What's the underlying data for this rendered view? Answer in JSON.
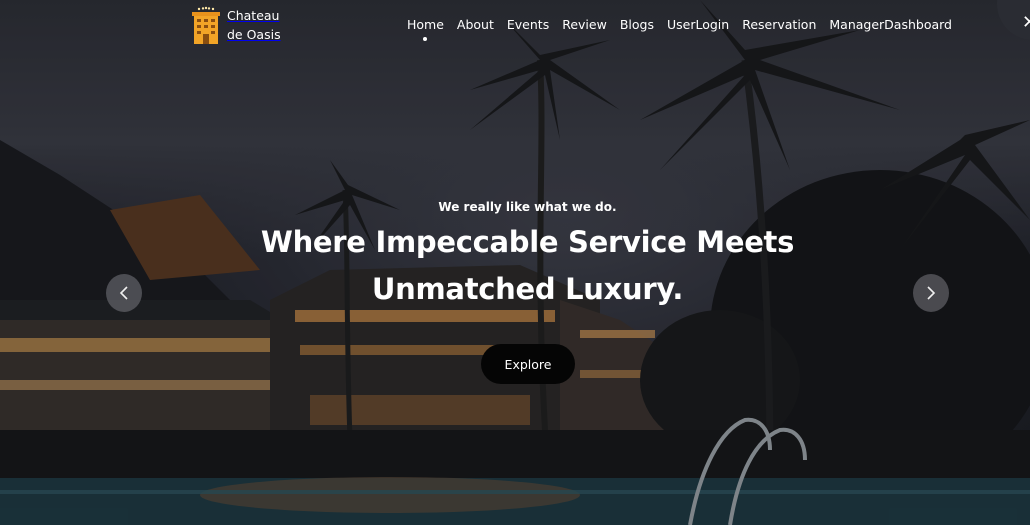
{
  "brand": {
    "name_line1": "Chateau",
    "name_line2": "de Oasis",
    "logo_icon": "hotel-building-icon",
    "logo_color": "#f2a427"
  },
  "nav": {
    "items": [
      {
        "label": "Home",
        "active": true
      },
      {
        "label": "About"
      },
      {
        "label": "Events"
      },
      {
        "label": "Review"
      },
      {
        "label": "Blogs"
      },
      {
        "label": "UserLogin"
      },
      {
        "label": "Reservation"
      },
      {
        "label": "ManagerDashboard"
      }
    ]
  },
  "hero": {
    "tagline": "We really like what we do.",
    "headline_line1": "Where Impeccable Service Meets",
    "headline_line2": "Unmatched Luxury.",
    "cta_label": "Explore",
    "prev_icon": "chevron-left-icon",
    "next_icon": "chevron-right-icon"
  },
  "colors": {
    "text": "#ffffff",
    "button_bg": "#050505",
    "arrow_bg": "#78787f"
  }
}
